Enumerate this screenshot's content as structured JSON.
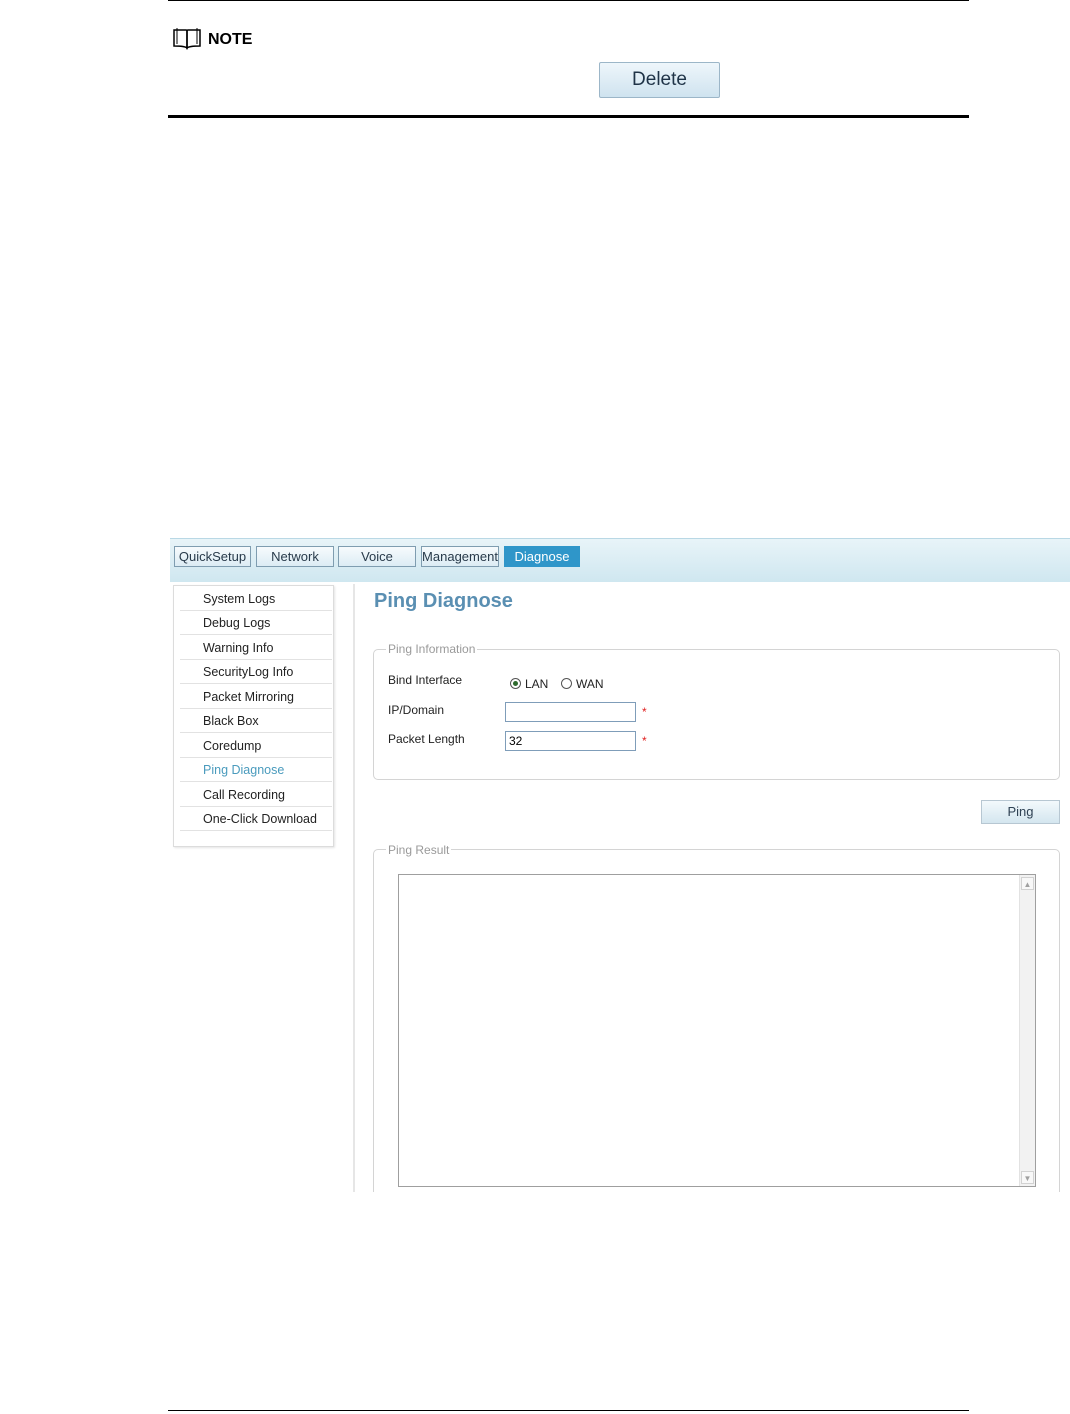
{
  "note": {
    "label": "NOTE",
    "button_label": "Delete"
  },
  "nav": {
    "tabs": [
      {
        "label": "QuickSetup"
      },
      {
        "label": "Network"
      },
      {
        "label": "Voice"
      },
      {
        "label": "Management"
      },
      {
        "label": "Diagnose",
        "active": true
      }
    ]
  },
  "sidebar": {
    "items": [
      {
        "label": "System Logs"
      },
      {
        "label": "Debug Logs"
      },
      {
        "label": "Warning Info"
      },
      {
        "label": "SecurityLog Info"
      },
      {
        "label": "Packet Mirroring"
      },
      {
        "label": "Black Box"
      },
      {
        "label": "Coredump"
      },
      {
        "label": "Ping Diagnose",
        "active": true
      },
      {
        "label": "Call Recording"
      },
      {
        "label": "One-Click Download"
      }
    ]
  },
  "main": {
    "title": "Ping Diagnose",
    "ping_info": {
      "legend": "Ping Information",
      "bind_interface_label": "Bind Interface",
      "options": [
        "LAN",
        "WAN"
      ],
      "selected": "LAN",
      "ip_domain_label": "IP/Domain",
      "ip_domain_value": "",
      "packet_length_label": "Packet Length",
      "packet_length_value": "32",
      "required_mark": "*"
    },
    "ping_button": "Ping",
    "result": {
      "legend": "Ping Result",
      "text": ""
    }
  },
  "colors": {
    "active_tab": "#2f96c9",
    "active_sidebar": "#4a9bbd",
    "title": "#5a8fb2",
    "required": "#e02020"
  }
}
